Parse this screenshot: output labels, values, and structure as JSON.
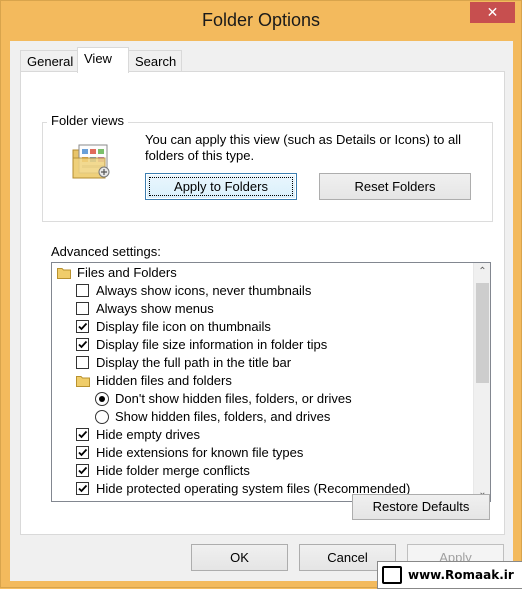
{
  "window": {
    "title": "Folder Options",
    "close_glyph": "✕"
  },
  "tabs": [
    {
      "label": "General",
      "active": false
    },
    {
      "label": "View",
      "active": true
    },
    {
      "label": "Search",
      "active": false
    }
  ],
  "folder_views": {
    "legend": "Folder views",
    "icon": "folder-views-icon",
    "description": "You can apply this view (such as Details or Icons) to all folders of this type.",
    "apply_label": "Apply to Folders",
    "reset_label": "Reset Folders"
  },
  "advanced": {
    "label": "Advanced settings:",
    "items": [
      {
        "kind": "folder",
        "label": "Files and Folders",
        "indent": 0
      },
      {
        "kind": "checkbox",
        "label": "Always show icons, never thumbnails",
        "checked": false,
        "indent": 1
      },
      {
        "kind": "checkbox",
        "label": "Always show menus",
        "checked": false,
        "indent": 1
      },
      {
        "kind": "checkbox",
        "label": "Display file icon on thumbnails",
        "checked": true,
        "indent": 1
      },
      {
        "kind": "checkbox",
        "label": "Display file size information in folder tips",
        "checked": true,
        "indent": 1
      },
      {
        "kind": "checkbox",
        "label": "Display the full path in the title bar",
        "checked": false,
        "indent": 1
      },
      {
        "kind": "folder",
        "label": "Hidden files and folders",
        "indent": 1
      },
      {
        "kind": "radio",
        "label": "Don't show hidden files, folders, or drives",
        "checked": true,
        "indent": 2
      },
      {
        "kind": "radio",
        "label": "Show hidden files, folders, and drives",
        "checked": false,
        "indent": 2
      },
      {
        "kind": "checkbox",
        "label": "Hide empty drives",
        "checked": true,
        "indent": 1
      },
      {
        "kind": "checkbox",
        "label": "Hide extensions for known file types",
        "checked": true,
        "indent": 1
      },
      {
        "kind": "checkbox",
        "label": "Hide folder merge conflicts",
        "checked": true,
        "indent": 1
      },
      {
        "kind": "checkbox",
        "label": "Hide protected operating system files (Recommended)",
        "checked": true,
        "indent": 1
      }
    ],
    "restore_label": "Restore Defaults"
  },
  "footer": {
    "ok_label": "OK",
    "cancel_label": "Cancel",
    "apply_label": "Apply"
  },
  "watermark": {
    "text": "www.Romaak.ir"
  },
  "colors": {
    "accent_focus": "#3c7fb1",
    "close_red": "#c74f4f",
    "frame": "#f3ba5d"
  }
}
